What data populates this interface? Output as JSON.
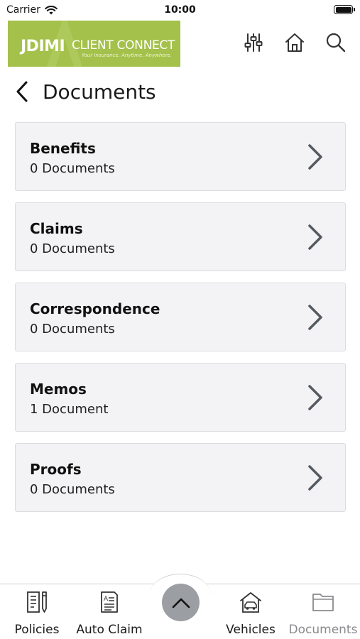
{
  "status_bar": {
    "carrier": "Carrier",
    "time": "10:00"
  },
  "header": {
    "logo": {
      "mark": "JDIMI",
      "main": "CLIENT CONNECT",
      "tagline": "Your Insurance. Anytime. Anywhere."
    },
    "icons": [
      "sliders-icon",
      "home-icon",
      "search-icon"
    ]
  },
  "page": {
    "title": "Documents"
  },
  "categories": [
    {
      "title": "Benefits",
      "count": "0 Documents"
    },
    {
      "title": "Claims",
      "count": "0 Documents"
    },
    {
      "title": "Correspondence",
      "count": "0 Documents"
    },
    {
      "title": "Memos",
      "count": "1 Document"
    },
    {
      "title": "Proofs",
      "count": "0 Documents"
    }
  ],
  "tab_bar": {
    "tabs": [
      {
        "label": "Policies",
        "icon": "policy-document-icon"
      },
      {
        "label": "Auto Claim",
        "icon": "auto-claim-icon"
      },
      {
        "label": "Vehicles",
        "icon": "vehicle-garage-icon"
      },
      {
        "label": "Documents",
        "icon": "folder-icon"
      }
    ],
    "center_icon": "chevron-up-icon"
  }
}
